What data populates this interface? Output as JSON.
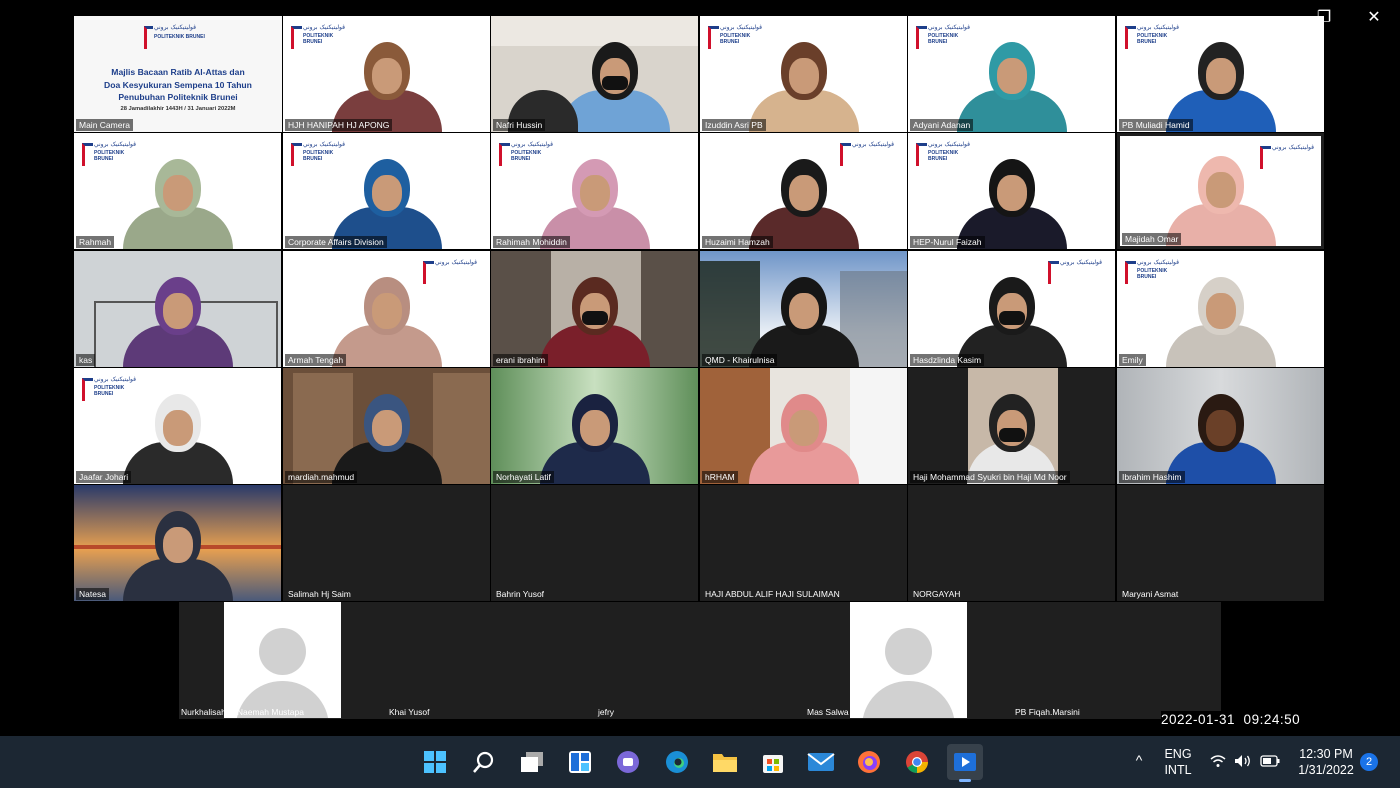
{
  "window_controls": {
    "minimize": "—",
    "restore": "❐",
    "close": "✕"
  },
  "banner": {
    "logo_arabic": "ڤوليتيکنيک بروني",
    "logo_text": "POLITEKNIK BRUNEI",
    "logo_anniversary": "10th Year Anniversary",
    "title_line1": "Majlis Bacaan Ratib Al-Attas dan",
    "title_line2": "Doa Kesyukuran Sempena 10 Tahun",
    "title_line3": "Penubuhan Politeknik Brunei",
    "date_line": "28 Jamadilakhir 1443H / 31 Januari 2022M",
    "camera_label": "Main Camera"
  },
  "participants": {
    "row1": [
      "HJH HANIPAH HJ APONG",
      "Nafri Hussin",
      "Izuddin Asri PB",
      "Adyani Adanan",
      "PB Muliadi Hamid"
    ],
    "row2": [
      "Rahmah",
      "Corporate Affairs Division",
      "Rahimah Mohiddin",
      "Huzaimi Hamzah",
      "HEP-Nurul Faizah",
      "Majidah Omar"
    ],
    "row3": [
      "kas",
      "Armah Tengah",
      "erani ibrahim",
      "QMD - Khairulnisa",
      "Hasdzlinda Kasim",
      "Emily"
    ],
    "row4": [
      "Jaafar Johari",
      "mardiah.mahmud",
      "Norhayati Latif",
      "hRHAM",
      "Haji Mohammad Syukri bin Haji Md Noor",
      "Ibrahim Hashim"
    ],
    "row5": [
      "Natesa",
      "Salimah Hj Saim",
      "Bahrin Yusof",
      "HAJI ABDUL ALIF HAJI SULAIMAN",
      "NORGAYAH",
      "Maryani Asmat"
    ],
    "row6": [
      "Nurkhalisah @Naemah Mustapa",
      "Khai Yusof",
      "jefry",
      "Mas Salwa",
      "PB Fiqah.Marsini"
    ]
  },
  "timestamp": "2022-01-31  09:24:50",
  "taskbar": {
    "icons": [
      "windows-start-icon",
      "search-icon",
      "task-view-icon",
      "widgets-icon",
      "teams-chat-icon",
      "edge-icon",
      "file-explorer-icon",
      "store-icon",
      "mail-icon",
      "firefox-icon",
      "chrome-icon",
      "media-player-icon"
    ],
    "language_line1": "ENG",
    "language_line2": "INTL",
    "time": "12:30 PM",
    "date": "1/31/2022",
    "notification_count": "2",
    "chevron": "^"
  },
  "colors": {
    "taskbar": "#1c2733",
    "logo_blue": "#1d3e8a",
    "logo_red": "#d0102b",
    "notification": "#1a73e8"
  }
}
